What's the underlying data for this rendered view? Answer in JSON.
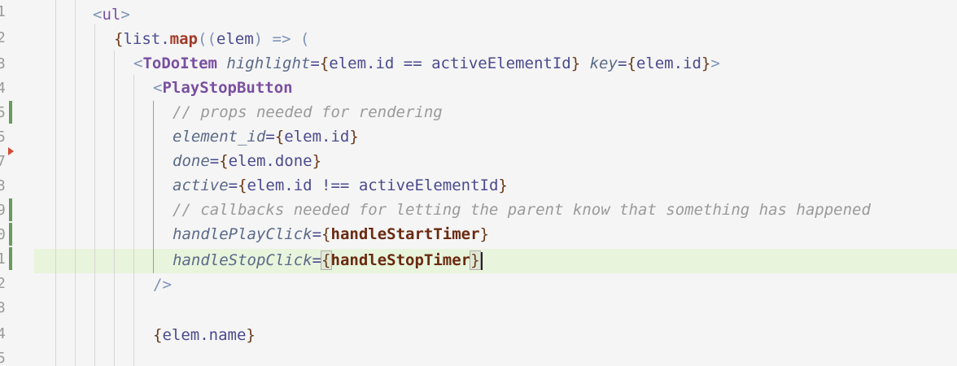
{
  "gutter": {
    "line_numbers": [
      "1",
      "2",
      "3",
      "4",
      "5",
      "5",
      "7",
      "3",
      "9",
      "0",
      "1",
      "2",
      "3",
      "4",
      "5"
    ]
  },
  "code": {
    "line1": {
      "open": "<",
      "tag": "ul",
      "close": ">"
    },
    "line2": {
      "brace_open": "{",
      "obj": "list",
      "dot": ".",
      "method": "map",
      "paren_open": "((",
      "param": "elem",
      "arrow": ") => ("
    },
    "line3": {
      "open": "<",
      "tag": "ToDoItem",
      "attr1": "highlight",
      "eq1": "=",
      "val1_open": "{",
      "val1": "elem.id == activeElementId",
      "val1_close": "}",
      "attr2": "key",
      "eq2": "=",
      "val2_open": "{",
      "val2": "elem.id",
      "val2_close": "}",
      "close": ">"
    },
    "line4": {
      "open": "<",
      "tag": "PlayStopButton"
    },
    "line5": {
      "comment": "// props needed for rendering"
    },
    "line6": {
      "attr": "element_id",
      "eq": "=",
      "bopen": "{",
      "val": "elem.id",
      "bclose": "}"
    },
    "line7": {
      "attr": "done",
      "eq": "=",
      "bopen": "{",
      "val": "elem.done",
      "bclose": "}"
    },
    "line8": {
      "attr": "active",
      "eq": "=",
      "bopen": "{",
      "val": "elem.id !== activeElementId",
      "bclose": "}"
    },
    "line9": {
      "comment": "// callbacks needed for letting the parent know that something has happened"
    },
    "line10": {
      "attr": "handlePlayClick",
      "eq": "=",
      "bopen": "{",
      "val": "handleStartTimer",
      "bclose": "}"
    },
    "line11": {
      "attr": "handleStopClick",
      "eq": "=",
      "bopen": "{",
      "val": "handleStopTimer",
      "bclose": "}"
    },
    "line12": {
      "selfclose": "/>"
    },
    "line14": {
      "bopen": "{",
      "val": "elem.name",
      "bclose": "}"
    }
  },
  "colors": {
    "background": "#f5f5f5",
    "current_line_highlight": "#e8f4dc",
    "git_added": "#6a9a5b",
    "git_deleted": "#d24b33",
    "tag": "#7a4fa0",
    "comment": "#9a9a9a",
    "function": "#a33a2a"
  },
  "icons": {
    "git_change_marker": "git-added-bar",
    "git_deleted_marker": "git-deleted-triangle"
  }
}
